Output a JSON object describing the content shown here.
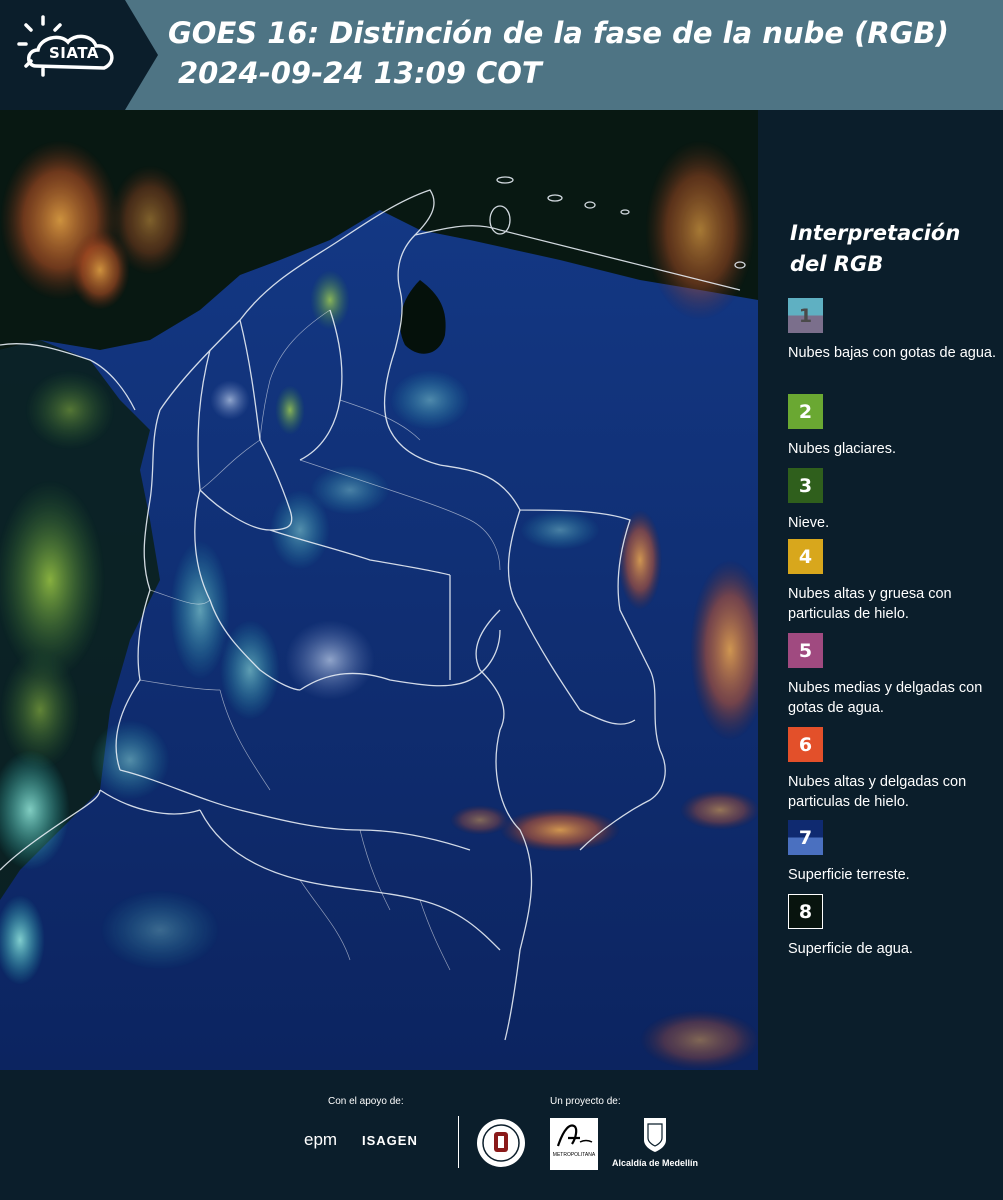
{
  "header": {
    "logo_text": "SIATA",
    "title": "GOES 16: Distinción de la fase de la nube (RGB)",
    "subtitle": "2024-09-24 13:09 COT"
  },
  "legend": {
    "title": "Interpretación del RGB",
    "items": [
      {
        "number": "1",
        "label": "Nubes bajas con gotas de agua.",
        "color_top": "#5fb0c2",
        "color_bottom": "#7b6f8c"
      },
      {
        "number": "2",
        "label": "Nubes glaciares.",
        "color": "#6aa832"
      },
      {
        "number": "3",
        "label": "Nieve.",
        "color": "#2f5f1c"
      },
      {
        "number": "4",
        "label": "Nubes altas y gruesa con particulas de hielo.",
        "color": "#d8a71c"
      },
      {
        "number": "5",
        "label": "Nubes medias y delgadas con gotas de agua.",
        "color": "#a04a80"
      },
      {
        "number": "6",
        "label": "Nubes altas y delgadas con particulas de hielo.",
        "color": "#e3502a"
      },
      {
        "number": "7",
        "label": "Superficie terreste.",
        "color_top": "#0f2a70",
        "color_bottom": "#4a70c0"
      },
      {
        "number": "8",
        "label": "Superficie de agua.",
        "color": "#08140e"
      }
    ]
  },
  "footer": {
    "support_label": "Con el apoyo de:",
    "project_label": "Un proyecto de:",
    "sponsor_1": "epm",
    "sponsor_2": "ISAGEN",
    "partner_1_text": "METROPOLITANA",
    "partner_2": "Alcaldía de Medellín"
  }
}
